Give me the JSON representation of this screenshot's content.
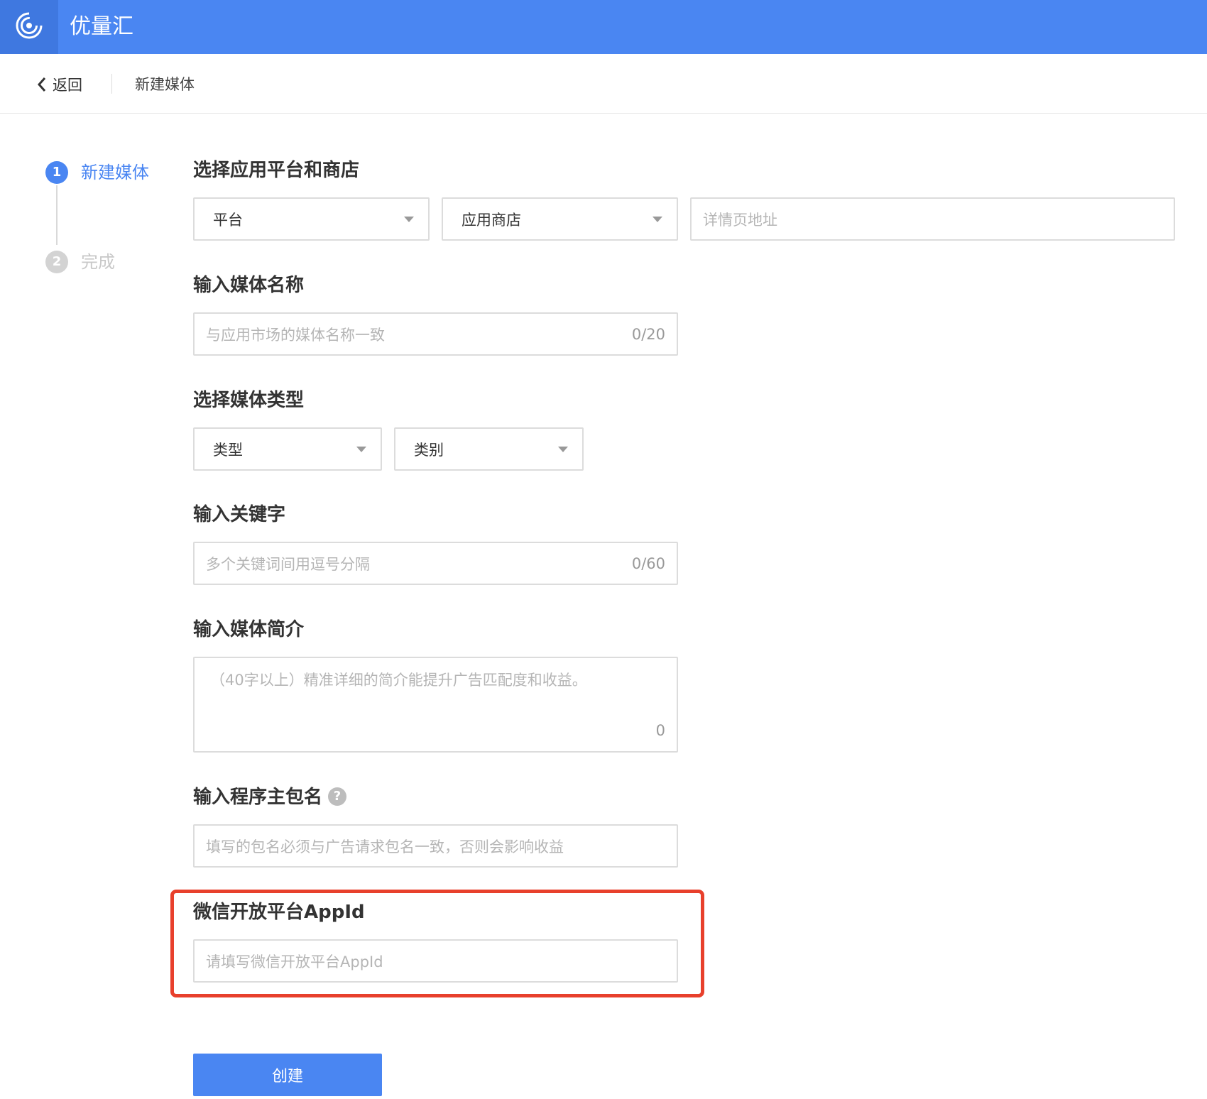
{
  "header": {
    "brand": "优量汇",
    "logo_icon": "target-logo-icon",
    "brand_color": "#4a86f2"
  },
  "subbar": {
    "back_label": "返回",
    "breadcrumb": "新建媒体"
  },
  "steps": [
    {
      "number": "1",
      "label": "新建媒体",
      "state": "active"
    },
    {
      "number": "2",
      "label": "完成",
      "state": "pending"
    }
  ],
  "form": {
    "platform_section": {
      "title": "选择应用平台和商店",
      "platform_select": "平台",
      "store_select": "应用商店",
      "detail_url_placeholder": "详情页地址"
    },
    "media_name": {
      "title": "输入媒体名称",
      "placeholder": "与应用市场的媒体名称一致",
      "counter": "0/20"
    },
    "media_type": {
      "title": "选择媒体类型",
      "type_select": "类型",
      "category_select": "类别"
    },
    "keywords": {
      "title": "输入关键字",
      "placeholder": "多个关键词间用逗号分隔",
      "counter": "0/60"
    },
    "intro": {
      "title": "输入媒体简介",
      "placeholder": "（40字以上）精准详细的简介能提升广告匹配度和收益。",
      "counter": "0"
    },
    "package": {
      "title": "输入程序主包名",
      "help_icon": "question-circle-icon",
      "help_glyph": "?",
      "placeholder": "填写的包名必须与广告请求包名一致，否则会影响收益"
    },
    "wechat_appid": {
      "title": "微信开放平台AppId",
      "placeholder": "请填写微信开放平台AppId",
      "highlight_color": "#e8402c"
    },
    "submit_label": "创建"
  }
}
